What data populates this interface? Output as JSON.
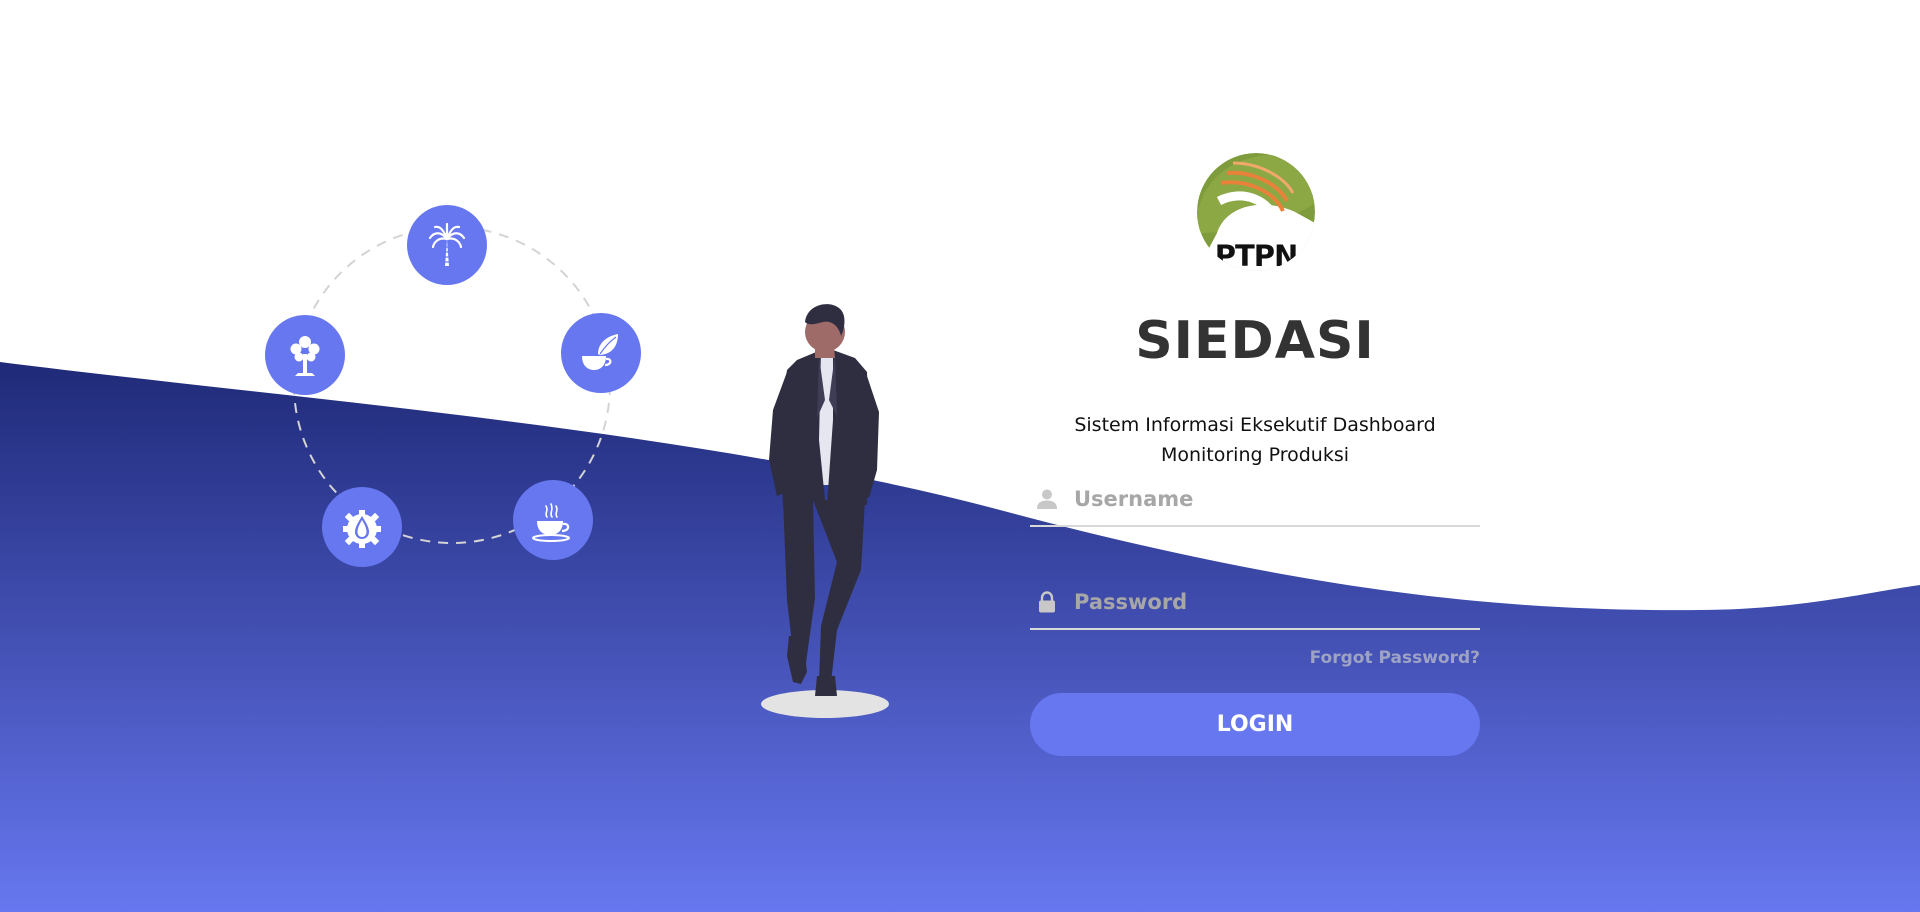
{
  "brand": {
    "logo_text": "PTPN",
    "app_title": "SIEDASI",
    "app_subtitle": "Sistem Informasi Eksekutif Dashboard Monitoring Produksi"
  },
  "form": {
    "username_placeholder": "Username",
    "password_placeholder": "Password",
    "forgot_password_label": "Forgot Password?",
    "login_label": "LOGIN"
  },
  "icons": {
    "commodities": [
      "palm-tree-icon",
      "tree-icon",
      "tea-leaf-icon",
      "oil-drop-gear-icon",
      "coffee-cup-icon"
    ],
    "username": "user-icon",
    "password": "lock-icon"
  },
  "colors": {
    "accent": "#6777ef",
    "wave_top": "#1f2a78",
    "wave_bottom": "#6777ef",
    "title": "#333333",
    "forgot_link": "#9ea3c4"
  }
}
